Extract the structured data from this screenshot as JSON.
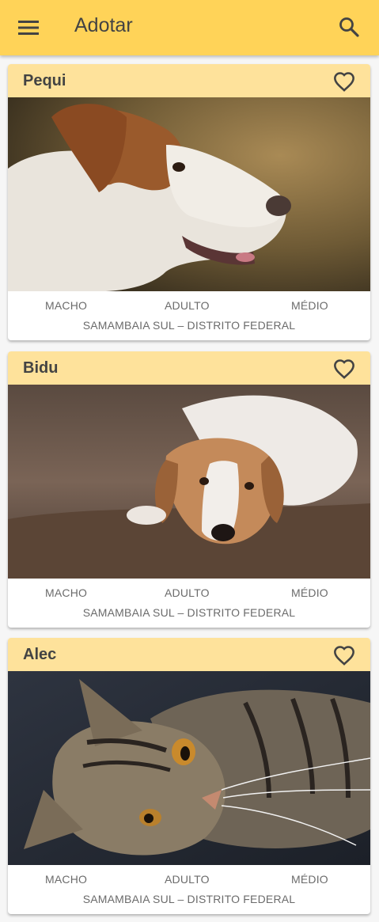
{
  "appbar": {
    "title": "Adotar",
    "menu_icon": "hamburger-menu-icon",
    "search_icon": "search-icon",
    "color": "#ffd358"
  },
  "colors": {
    "card_header": "#fee29b",
    "text": "#434343",
    "secondary_text": "#6b6b6b"
  },
  "pets": [
    {
      "name": "Pequi",
      "sex": "MACHO",
      "age": "ADULTO",
      "size": "MÉDIO",
      "location": "SAMAMBAIA SUL – DISTRITO FEDERAL",
      "favorite_icon": "heart-outline-icon"
    },
    {
      "name": "Bidu",
      "sex": "MACHO",
      "age": "ADULTO",
      "size": "MÉDIO",
      "location": "SAMAMBAIA SUL – DISTRITO FEDERAL",
      "favorite_icon": "heart-outline-icon"
    },
    {
      "name": "Alec",
      "sex": "MACHO",
      "age": "ADULTO",
      "size": "MÉDIO",
      "location": "SAMAMBAIA SUL – DISTRITO FEDERAL",
      "favorite_icon": "heart-outline-icon"
    }
  ]
}
